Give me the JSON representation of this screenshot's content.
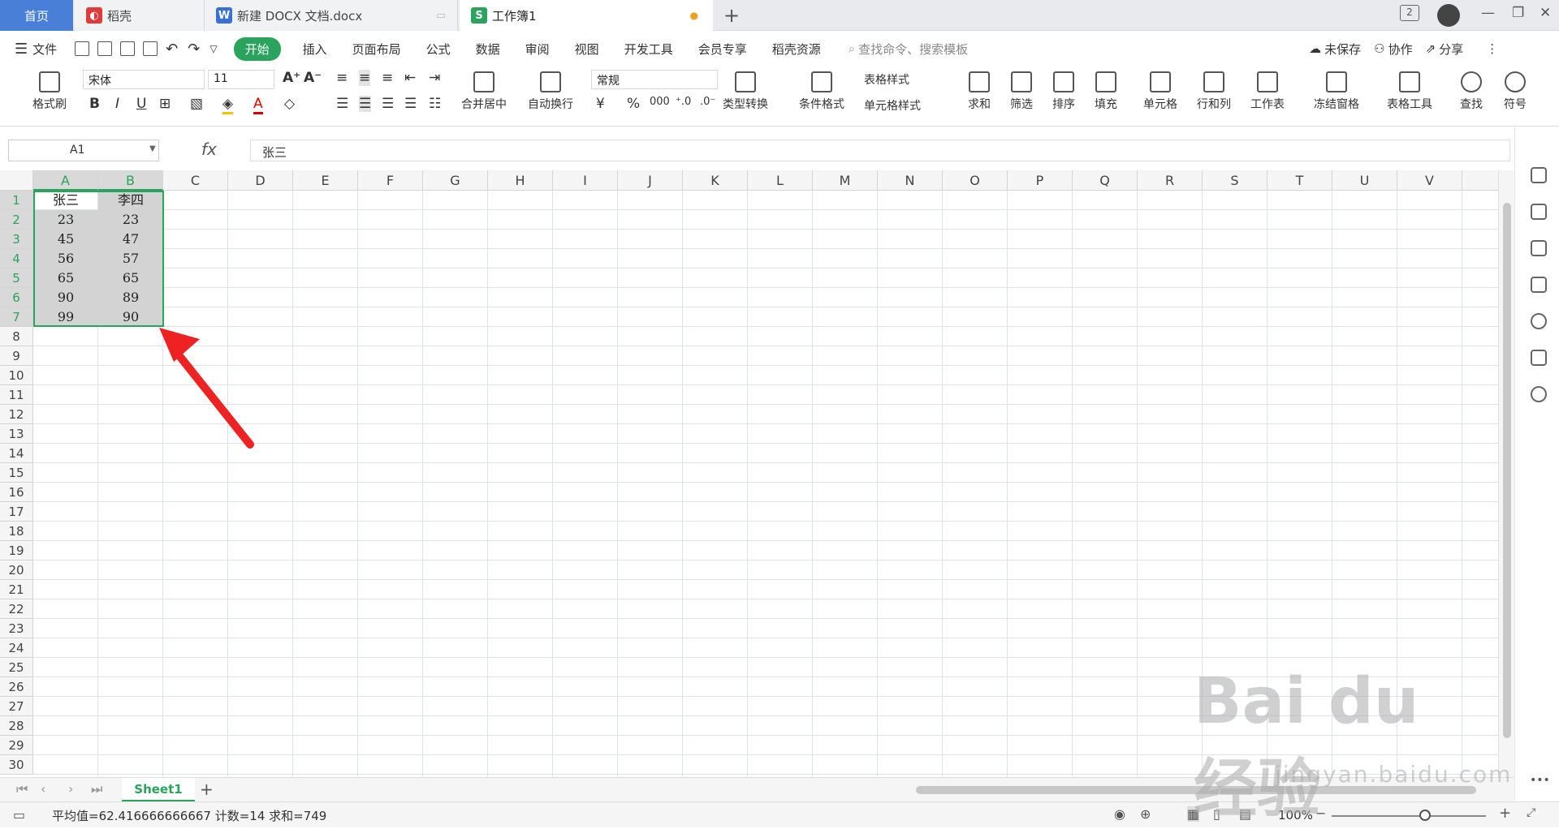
{
  "tabs": [
    {
      "label": "首页"
    },
    {
      "label": "稻壳"
    },
    {
      "label": "新建 DOCX 文档.docx"
    },
    {
      "label": "工作簿1"
    }
  ],
  "window": {
    "badge": "2"
  },
  "menu": {
    "file": "文件",
    "items": [
      "开始",
      "插入",
      "页面布局",
      "公式",
      "数据",
      "审阅",
      "视图",
      "开发工具",
      "会员专享",
      "稻壳资源"
    ],
    "search_placeholder": "查找命令、搜索模板",
    "unsaved": "未保存",
    "collab": "协作",
    "share": "分享"
  },
  "ribbon": {
    "format_painter": "格式刷",
    "font": "宋体",
    "size": "11",
    "bold": "B",
    "italic": "I",
    "underline": "U",
    "merge": "合并居中",
    "wrap": "自动换行",
    "numfmt": "常规",
    "currency": "¥",
    "percent": "%",
    "thousands": "000",
    "convert": "类型转换",
    "cond_format": "条件格式",
    "table_style": "表格样式",
    "cell_style": "单元格样式",
    "sum": "求和",
    "filter": "筛选",
    "sort": "排序",
    "fill": "填充",
    "cell": "单元格",
    "rowcol": "行和列",
    "sheet": "工作表",
    "freeze": "冻结窗格",
    "tools": "表格工具",
    "find": "查找",
    "symbol": "符号"
  },
  "formula_bar": {
    "name_box": "A1",
    "fx": "fx",
    "value": "张三"
  },
  "columns": [
    "A",
    "B",
    "C",
    "D",
    "E",
    "F",
    "G",
    "H",
    "I",
    "J",
    "K",
    "L",
    "M",
    "N",
    "O",
    "P",
    "Q",
    "R",
    "S",
    "T",
    "U",
    "V"
  ],
  "rows": [
    "1",
    "2",
    "3",
    "4",
    "5",
    "6",
    "7",
    "8",
    "9",
    "10",
    "11",
    "12",
    "13",
    "14",
    "15",
    "16",
    "17",
    "18",
    "19",
    "20",
    "21",
    "22",
    "23",
    "24",
    "25",
    "26",
    "27",
    "28",
    "29",
    "30"
  ],
  "cells": [
    [
      "张三",
      "李四"
    ],
    [
      "23",
      "23"
    ],
    [
      "45",
      "47"
    ],
    [
      "56",
      "57"
    ],
    [
      "65",
      "65"
    ],
    [
      "90",
      "89"
    ],
    [
      "99",
      "90"
    ]
  ],
  "sheet": {
    "name": "Sheet1"
  },
  "status": {
    "stats": "平均值=62.416666666667  计数=14  求和=749",
    "zoom": "100%"
  },
  "watermark": {
    "brand": "Bai du 经验",
    "url": "jingyan.baidu.com"
  }
}
